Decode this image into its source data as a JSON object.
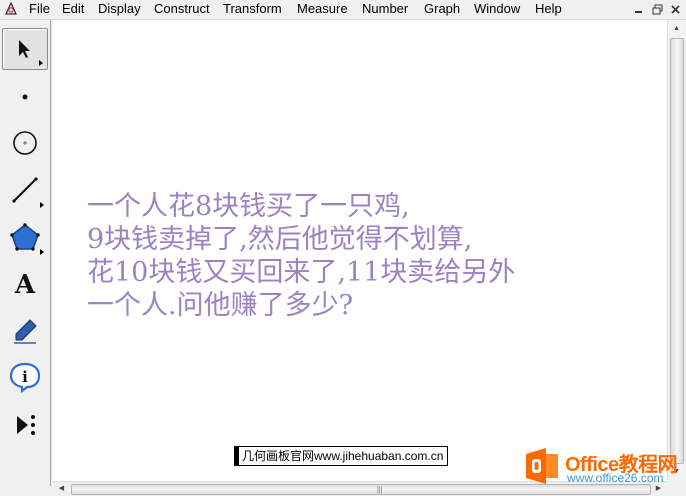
{
  "menubar": {
    "items": [
      "File",
      "Edit",
      "Display",
      "Construct",
      "Transform",
      "Measure",
      "Number",
      "Graph",
      "Window",
      "Help"
    ],
    "window_buttons": [
      "minimize",
      "restore",
      "close"
    ]
  },
  "toolbox": {
    "tools": [
      {
        "name": "arrow-select-tool",
        "selected": true
      },
      {
        "name": "point-tool"
      },
      {
        "name": "compass-tool"
      },
      {
        "name": "straightedge-tool"
      },
      {
        "name": "polygon-tool"
      },
      {
        "name": "text-tool",
        "glyph": "A"
      },
      {
        "name": "marker-tool"
      },
      {
        "name": "information-tool",
        "glyph": "i"
      },
      {
        "name": "custom-tool"
      }
    ]
  },
  "canvas": {
    "text_color": "#9d82c2",
    "lines": [
      "一个人花8块钱买了一只鸡,",
      "9块钱卖掉了,然后他觉得不划算,",
      "花10块钱又买回来了,11块卖给另外",
      "一个人.问他赚了多少?"
    ]
  },
  "watermarks": {
    "site": "几何画板官网www.jihehuaban.com.cn",
    "brand_name": "Office教程网",
    "brand_url": "www.office26.com",
    "brand_color": "#ff6a00"
  },
  "scrollbars": {
    "vertical_up": "▲",
    "vertical_down": "▼",
    "horizontal_left": "◀",
    "horizontal_right": "▶"
  }
}
